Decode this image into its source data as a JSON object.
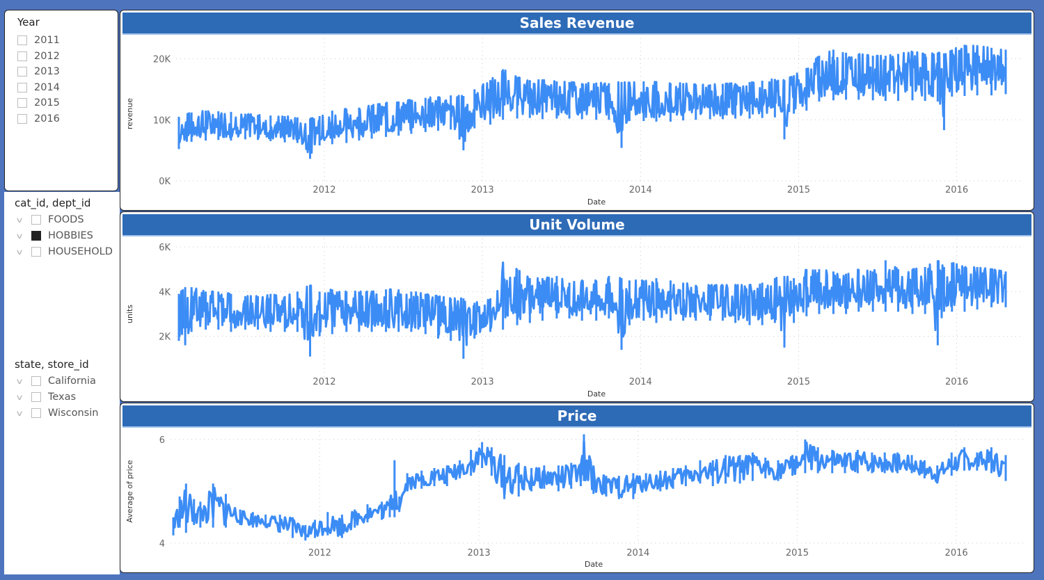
{
  "background_color": "#4f74be",
  "accent_color": "#2e6bb7",
  "line_color": "#3c8cf5",
  "slicers": {
    "year": {
      "title": "Year",
      "items": [
        {
          "label": "2011",
          "checked": false
        },
        {
          "label": "2012",
          "checked": false
        },
        {
          "label": "2013",
          "checked": false
        },
        {
          "label": "2014",
          "checked": false
        },
        {
          "label": "2015",
          "checked": false
        },
        {
          "label": "2016",
          "checked": false
        }
      ]
    },
    "category": {
      "title": "cat_id, dept_id",
      "items": [
        {
          "label": "FOODS",
          "checked": false
        },
        {
          "label": "HOBBIES",
          "checked": true
        },
        {
          "label": "HOUSEHOLD",
          "checked": false
        }
      ]
    },
    "state": {
      "title": "state, store_id",
      "items": [
        {
          "label": "California",
          "checked": false
        },
        {
          "label": "Texas",
          "checked": false
        },
        {
          "label": "Wisconsin",
          "checked": false
        }
      ]
    }
  },
  "chart_data": [
    {
      "id": "revenue",
      "type": "line",
      "title": "Sales Revenue",
      "xlabel": "Date",
      "ylabel": "revenue",
      "x_range": [
        2011.08,
        2016.31
      ],
      "x_ticks": [
        2012,
        2013,
        2014,
        2015,
        2016
      ],
      "x_tick_labels": [
        "2012",
        "2013",
        "2014",
        "2015",
        "2016"
      ],
      "ylim": [
        0,
        22000
      ],
      "y_ticks": [
        0,
        10000,
        20000
      ],
      "y_tick_labels": [
        "0K",
        "10K",
        "20K"
      ],
      "grid": true,
      "note": "dense daily series approximated by per-period low/high envelope",
      "x": [
        2011.08,
        2011.16,
        2011.25,
        2011.33,
        2011.41,
        2011.5,
        2011.58,
        2011.66,
        2011.75,
        2011.83,
        2011.91,
        2011.97,
        2012.05,
        2012.14,
        2012.22,
        2012.3,
        2012.39,
        2012.47,
        2012.55,
        2012.64,
        2012.72,
        2012.8,
        2012.88,
        2012.95,
        2013.05,
        2013.13,
        2013.22,
        2013.3,
        2013.38,
        2013.47,
        2013.55,
        2013.63,
        2013.72,
        2013.8,
        2013.88,
        2013.93,
        2014.02,
        2014.1,
        2014.19,
        2014.27,
        2014.35,
        2014.44,
        2014.52,
        2014.6,
        2014.69,
        2014.77,
        2014.85,
        2014.91,
        2014.97,
        2015.05,
        2015.13,
        2015.22,
        2015.3,
        2015.38,
        2015.47,
        2015.55,
        2015.63,
        2015.72,
        2015.8,
        2015.88,
        2015.92,
        2015.97,
        2016.05,
        2016.13,
        2016.22,
        2016.31
      ],
      "low": [
        5200,
        6400,
        6600,
        6700,
        6600,
        6800,
        6700,
        6500,
        6300,
        6200,
        3600,
        5800,
        6000,
        6200,
        6600,
        6900,
        7200,
        7400,
        7700,
        8000,
        8200,
        8400,
        5000,
        8600,
        9200,
        10000,
        10200,
        10300,
        10100,
        10200,
        10200,
        10100,
        10000,
        10000,
        5400,
        9800,
        9800,
        9700,
        9700,
        9900,
        10000,
        10100,
        10100,
        10200,
        10200,
        10300,
        10400,
        6800,
        11000,
        11500,
        13000,
        13200,
        13300,
        13300,
        13200,
        13100,
        13100,
        13200,
        13100,
        13000,
        8300,
        13800,
        13900,
        14000,
        14000,
        14200
      ],
      "high": [
        10500,
        11200,
        11500,
        11400,
        11300,
        11000,
        10800,
        10700,
        10600,
        10400,
        10200,
        10600,
        11500,
        11800,
        12000,
        12400,
        12800,
        13000,
        13300,
        13600,
        13800,
        14000,
        13900,
        15000,
        16500,
        18300,
        17000,
        16500,
        16500,
        16300,
        16200,
        16000,
        16100,
        16000,
        16200,
        16100,
        16300,
        16200,
        16000,
        16000,
        15800,
        15800,
        15900,
        16000,
        16200,
        16400,
        16700,
        16500,
        17300,
        18500,
        20500,
        21500,
        21000,
        20800,
        20500,
        20500,
        20800,
        21200,
        20800,
        21000,
        20900,
        21500,
        22300,
        22100,
        21800,
        21500
      ]
    },
    {
      "id": "units",
      "type": "line",
      "title": "Unit Volume",
      "xlabel": "Date",
      "ylabel": "units",
      "x_range": [
        2011.08,
        2016.31
      ],
      "x_ticks": [
        2012,
        2013,
        2014,
        2015,
        2016
      ],
      "x_tick_labels": [
        "2012",
        "2013",
        "2014",
        "2015",
        "2016"
      ],
      "ylim": [
        0,
        6000
      ],
      "y_ticks": [
        2000,
        4000,
        6000
      ],
      "y_tick_labels": [
        "2K",
        "4K",
        "6K"
      ],
      "grid": true,
      "note": "dense daily series approximated by per-period low/high envelope",
      "x": [
        2011.08,
        2011.12,
        2011.16,
        2011.25,
        2011.33,
        2011.41,
        2011.5,
        2011.58,
        2011.66,
        2011.75,
        2011.83,
        2011.91,
        2011.97,
        2012.05,
        2012.14,
        2012.22,
        2012.3,
        2012.39,
        2012.47,
        2012.55,
        2012.64,
        2012.72,
        2012.8,
        2012.88,
        2012.95,
        2013.05,
        2013.13,
        2013.22,
        2013.3,
        2013.38,
        2013.47,
        2013.55,
        2013.63,
        2013.72,
        2013.8,
        2013.88,
        2013.93,
        2014.02,
        2014.1,
        2014.19,
        2014.27,
        2014.35,
        2014.44,
        2014.52,
        2014.6,
        2014.69,
        2014.77,
        2014.85,
        2014.91,
        2014.97,
        2015.05,
        2015.13,
        2015.22,
        2015.3,
        2015.38,
        2015.47,
        2015.55,
        2015.63,
        2015.72,
        2015.8,
        2015.88,
        2015.92,
        2015.97,
        2016.05,
        2016.13,
        2016.22,
        2016.31
      ],
      "low": [
        1800,
        1600,
        2200,
        2300,
        2300,
        2200,
        2300,
        2300,
        2200,
        2200,
        2200,
        1100,
        2000,
        2100,
        2200,
        2200,
        2200,
        2200,
        2200,
        2200,
        2100,
        1900,
        1800,
        1000,
        1900,
        2200,
        2300,
        2500,
        2600,
        2700,
        2800,
        2800,
        2700,
        2700,
        2800,
        1400,
        2500,
        2700,
        2600,
        2700,
        2700,
        2700,
        2700,
        2700,
        2600,
        2500,
        2500,
        2600,
        1500,
        2600,
        2900,
        3000,
        3000,
        3000,
        3100,
        3100,
        3100,
        3100,
        3000,
        3000,
        1600,
        3100,
        3100,
        3100,
        3200,
        3300,
        3300
      ],
      "high": [
        3900,
        4200,
        4200,
        4000,
        4000,
        3900,
        3800,
        3800,
        3900,
        3800,
        4000,
        4300,
        4000,
        4100,
        4000,
        4000,
        4000,
        4100,
        4100,
        4000,
        3900,
        3800,
        3700,
        3700,
        3500,
        3700,
        5300,
        5000,
        4600,
        4600,
        4700,
        4400,
        4500,
        4500,
        4700,
        4600,
        4500,
        4500,
        4600,
        4500,
        4400,
        4300,
        4300,
        4300,
        4300,
        4300,
        4400,
        4600,
        4700,
        4600,
        5000,
        5000,
        4900,
        4800,
        5000,
        4900,
        5400,
        5000,
        5000,
        5100,
        5400,
        5100,
        5300,
        5100,
        5100,
        5000,
        4900
      ]
    },
    {
      "id": "price",
      "type": "line",
      "title": "Price",
      "xlabel": "Date",
      "ylabel": "Average of price",
      "x_range": [
        2011.08,
        2016.31
      ],
      "x_ticks": [
        2012,
        2013,
        2014,
        2015,
        2016
      ],
      "x_tick_labels": [
        "2012",
        "2013",
        "2014",
        "2015",
        "2016"
      ],
      "ylim": [
        4,
        6
      ],
      "y_ticks": [
        4,
        6
      ],
      "y_tick_labels": [
        "4",
        "6"
      ],
      "grid": true,
      "note": "dense daily series approximated by per-period low/high envelope",
      "x": [
        2011.08,
        2011.12,
        2011.16,
        2011.21,
        2011.25,
        2011.33,
        2011.41,
        2011.5,
        2011.58,
        2011.66,
        2011.75,
        2011.83,
        2011.91,
        2011.97,
        2012.05,
        2012.14,
        2012.22,
        2012.3,
        2012.39,
        2012.44,
        2012.47,
        2012.5,
        2012.55,
        2012.64,
        2012.72,
        2012.8,
        2012.88,
        2012.95,
        2013.02,
        2013.08,
        2013.16,
        2013.25,
        2013.33,
        2013.41,
        2013.5,
        2013.58,
        2013.64,
        2013.66,
        2013.72,
        2013.8,
        2013.88,
        2013.97,
        2014.05,
        2014.14,
        2014.22,
        2014.3,
        2014.39,
        2014.47,
        2014.55,
        2014.64,
        2014.72,
        2014.8,
        2014.88,
        2014.97,
        2015.05,
        2015.13,
        2015.22,
        2015.3,
        2015.38,
        2015.47,
        2015.55,
        2015.63,
        2015.72,
        2015.8,
        2015.88,
        2015.97,
        2016.05,
        2016.13,
        2016.22,
        2016.31
      ],
      "low": [
        4.15,
        4.3,
        4.2,
        4.35,
        4.3,
        4.3,
        4.3,
        4.35,
        4.3,
        4.3,
        4.2,
        4.1,
        4.05,
        4.1,
        4.15,
        4.1,
        4.3,
        4.4,
        4.45,
        4.5,
        4.5,
        4.6,
        5.0,
        5.05,
        5.1,
        5.1,
        5.25,
        5.3,
        5.45,
        5.3,
        4.85,
        4.9,
        5.0,
        5.05,
        5.0,
        5.05,
        5.1,
        5.2,
        4.95,
        4.9,
        4.85,
        4.85,
        5.0,
        5.0,
        5.05,
        5.1,
        5.15,
        5.1,
        5.15,
        5.15,
        5.2,
        5.25,
        5.2,
        5.3,
        5.35,
        5.35,
        5.35,
        5.35,
        5.35,
        5.35,
        5.35,
        5.35,
        5.35,
        5.25,
        5.15,
        5.3,
        5.4,
        5.4,
        5.35,
        5.2
      ],
      "high": [
        4.5,
        4.9,
        5.15,
        4.85,
        4.8,
        5.15,
        4.95,
        4.65,
        4.6,
        4.55,
        4.55,
        4.5,
        4.35,
        4.45,
        4.6,
        4.55,
        4.65,
        4.75,
        4.8,
        4.85,
        5.6,
        4.9,
        5.35,
        5.4,
        5.45,
        5.5,
        5.6,
        5.8,
        5.95,
        5.85,
        5.7,
        5.55,
        5.45,
        5.5,
        5.5,
        5.55,
        5.55,
        6.1,
        5.5,
        5.3,
        5.3,
        5.35,
        5.35,
        5.4,
        5.45,
        5.5,
        5.6,
        5.6,
        5.7,
        5.7,
        5.75,
        5.65,
        5.6,
        5.7,
        6.0,
        5.85,
        5.8,
        5.75,
        5.8,
        5.75,
        5.75,
        5.75,
        5.7,
        5.6,
        5.5,
        5.75,
        5.85,
        5.75,
        5.85,
        5.7
      ]
    }
  ]
}
